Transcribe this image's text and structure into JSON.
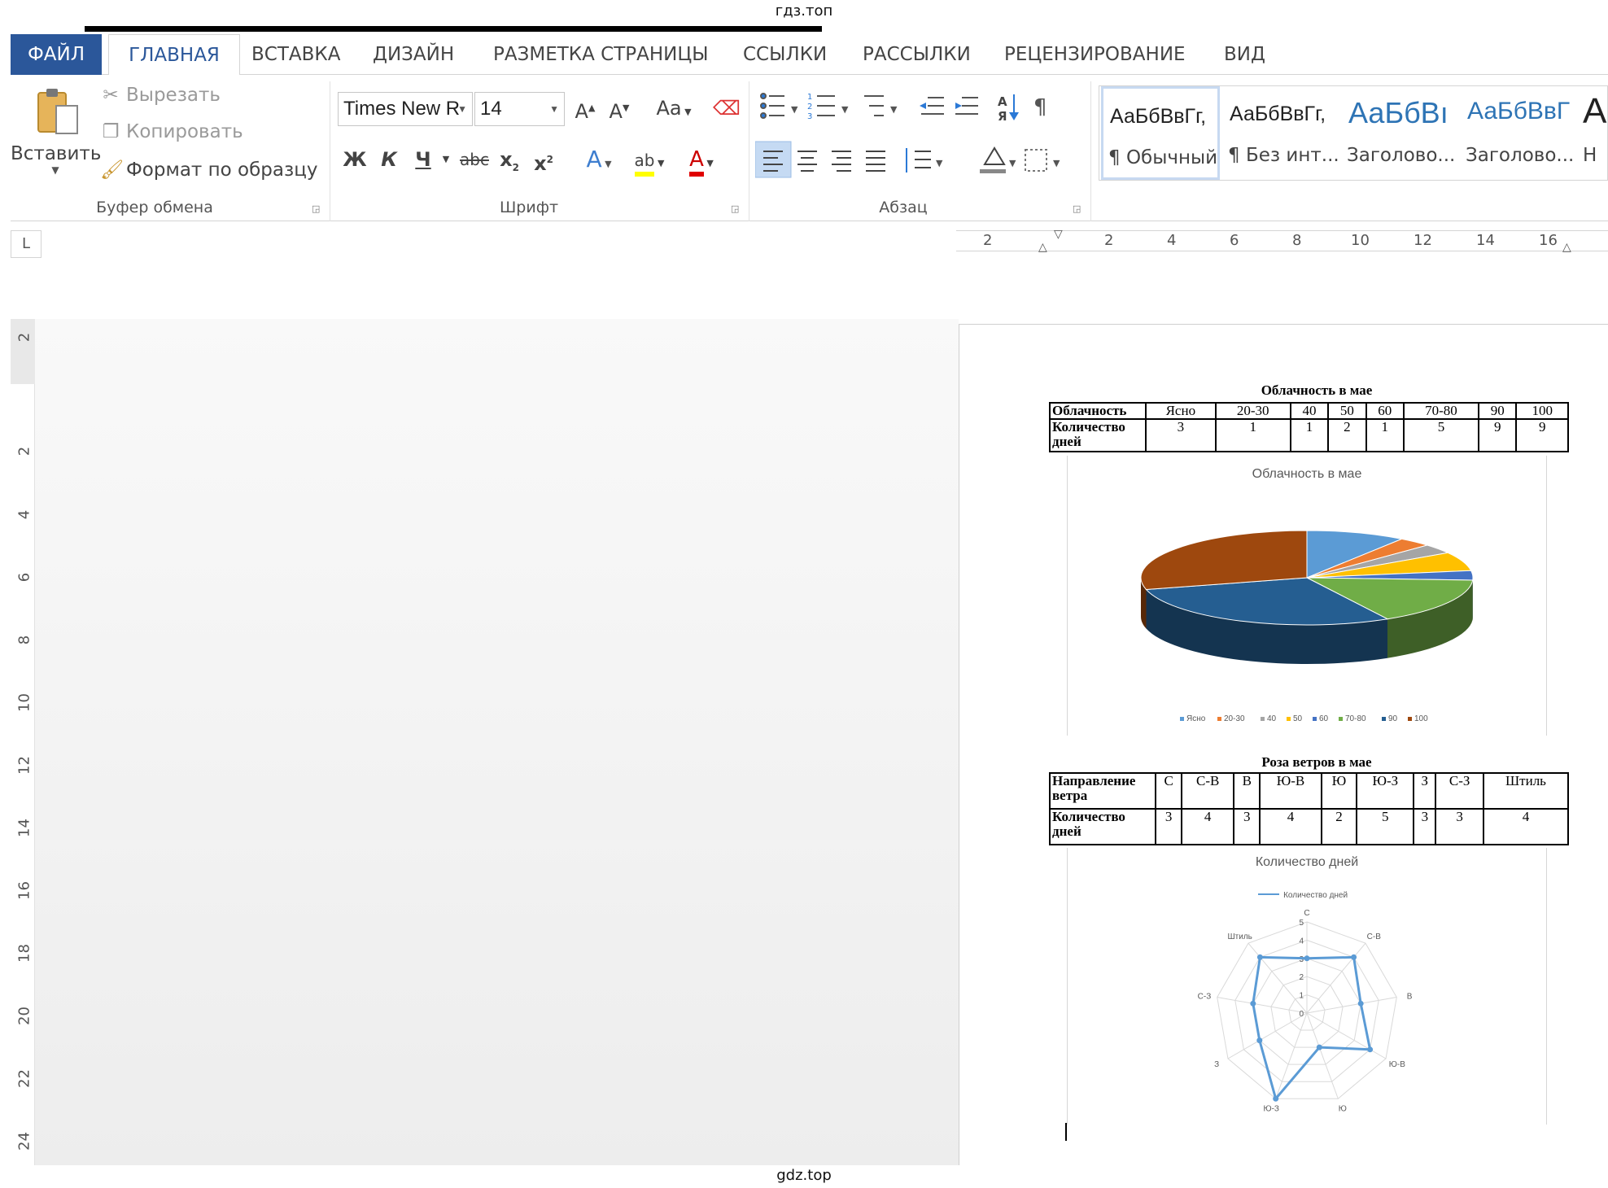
{
  "watermarks": {
    "top": "гдз.топ",
    "bottom": "gdz.top"
  },
  "tabs": [
    {
      "label": "ФАЙЛ"
    },
    {
      "label": "ГЛАВНАЯ"
    },
    {
      "label": "ВСТАВКА"
    },
    {
      "label": "ДИЗАЙН"
    },
    {
      "label": "РАЗМЕТКА СТРАНИЦЫ"
    },
    {
      "label": "ССЫЛКИ"
    },
    {
      "label": "РАССЫЛКИ"
    },
    {
      "label": "РЕЦЕНЗИРОВАНИЕ"
    },
    {
      "label": "ВИД"
    }
  ],
  "clipboard": {
    "paste_label": "Вставить",
    "cut_label": "Вырезать",
    "copy_label": "Копировать",
    "format_painter_label": "Формат по образцу",
    "group_label": "Буфер обмена"
  },
  "font": {
    "name_value": "Times New R",
    "size_value": "14",
    "change_case_label": "Aa",
    "bold_label": "Ж",
    "italic_label": "К",
    "underline_label": "Ч",
    "strike_label": "abc",
    "text_color": "#e00000",
    "highlight_color": "#ffff00",
    "group_label": "Шрифт"
  },
  "paragraph": {
    "group_label": "Абзац"
  },
  "styles": [
    {
      "sample": "АаБбВвГг,",
      "name": "¶ Обычный",
      "color": "#222222"
    },
    {
      "sample": "АаБбВвГг,",
      "name": "¶ Без инт...",
      "color": "#222222"
    },
    {
      "sample": "АаБбВı",
      "name": "Заголово...",
      "color": "#2e74b5"
    },
    {
      "sample": "АаБбВвГ",
      "name": "Заголово...",
      "color": "#2e74b5"
    },
    {
      "sample": "А",
      "name": "Н",
      "color": "#222222"
    }
  ],
  "ruler": {
    "corner": "L",
    "h_numbers": [
      "2",
      "2",
      "4",
      "6",
      "8",
      "10",
      "12",
      "14",
      "16"
    ],
    "v_numbers": [
      "2",
      "2",
      "4",
      "6",
      "8",
      "10",
      "12",
      "14",
      "16",
      "18",
      "20",
      "22",
      "24"
    ]
  },
  "cloud": {
    "title": "Облачность в мае",
    "row1_header": "Облачность",
    "row2_header": "Количество дней",
    "categories": [
      "Ясно",
      "20-30",
      "40",
      "50",
      "60",
      "70-80",
      "90",
      "100"
    ],
    "counts": [
      "3",
      "1",
      "1",
      "2",
      "1",
      "5",
      "9",
      "9"
    ]
  },
  "wind": {
    "title": "Роза ветров в мае",
    "row1_header": "Направление ветра",
    "row2_header": "Количество дней",
    "directions": [
      "С",
      "С-В",
      "В",
      "Ю-В",
      "Ю",
      "Ю-З",
      "З",
      "С-З",
      "Штиль"
    ],
    "counts": [
      "3",
      "4",
      "3",
      "4",
      "2",
      "5",
      "3",
      "3",
      "4"
    ]
  },
  "chart_data": [
    {
      "type": "pie",
      "title": "Облачность в  мае",
      "categories": [
        "Ясно",
        "20-30",
        "40",
        "50",
        "60",
        "70-80",
        "90",
        "100"
      ],
      "values": [
        3,
        1,
        1,
        2,
        1,
        5,
        9,
        9
      ],
      "colors": [
        "#5b9bd5",
        "#ed7d31",
        "#a5a5a5",
        "#ffc000",
        "#4472c4",
        "#70ad47",
        "#255e91",
        "#9e480e"
      ],
      "legend_position": "bottom",
      "style": "3d"
    },
    {
      "type": "radar",
      "title": "Количество дней",
      "categories": [
        "С",
        "С-В",
        "В",
        "Ю-В",
        "Ю",
        "Ю-З",
        "З",
        "С-З",
        "Штиль"
      ],
      "series": [
        {
          "name": "Количество дней",
          "values": [
            3,
            4,
            3,
            4,
            2,
            5,
            3,
            3,
            4
          ]
        }
      ],
      "rlim": [
        0,
        5
      ],
      "ticks": [
        "0",
        "1",
        "2",
        "3",
        "4",
        "5"
      ],
      "color": "#5b9bd5",
      "legend_position": "top"
    }
  ]
}
